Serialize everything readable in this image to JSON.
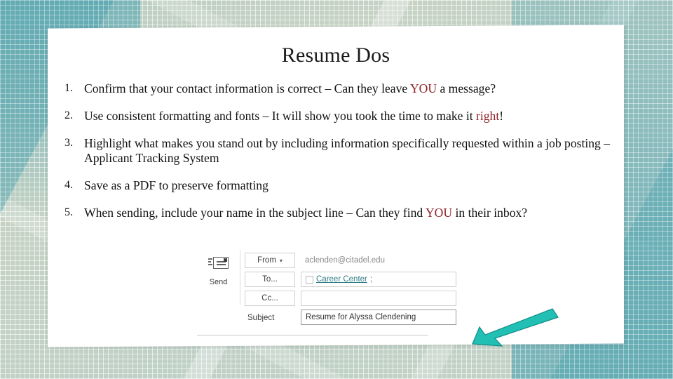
{
  "slide": {
    "title": "Resume Dos",
    "items": [
      {
        "num": "1.",
        "parts": [
          {
            "t": "Confirm that your contact information is correct – Can they leave ",
            "hl": false
          },
          {
            "t": "YOU",
            "hl": true
          },
          {
            "t": " a message?",
            "hl": false
          }
        ]
      },
      {
        "num": "2.",
        "parts": [
          {
            "t": "Use consistent formatting and fonts – It will show you took the time to make it ",
            "hl": false
          },
          {
            "t": "right",
            "hl": true
          },
          {
            "t": "!",
            "hl": false
          }
        ]
      },
      {
        "num": "3.",
        "parts": [
          {
            "t": "Highlight what makes you stand out by including information specifically requested within a job posting – Applicant Tracking System",
            "hl": false
          }
        ]
      },
      {
        "num": "4.",
        "parts": [
          {
            "t": "Save as a PDF to preserve formatting",
            "hl": false
          }
        ]
      },
      {
        "num": "5.",
        "parts": [
          {
            "t": "When sending, include your name in the subject line – Can they find ",
            "hl": false
          },
          {
            "t": "YOU",
            "hl": true
          },
          {
            "t": " in their inbox?",
            "hl": false
          }
        ]
      }
    ]
  },
  "email": {
    "send_label": "Send",
    "from_label": "From",
    "from_caret": "▾",
    "to_label": "To...",
    "cc_label": "Cc...",
    "subject_label": "Subject",
    "from_value": "aclenden@citadel.edu",
    "to_value": "Career Center",
    "to_separator": ";",
    "cc_value": "",
    "subject_value": "Resume for Alyssa Clendening"
  },
  "colors": {
    "highlight": "#8d2227",
    "arrow": "#22bfb4",
    "arrow_stroke": "#0f8d86",
    "background_sage": "#c3d2c6",
    "background_teal": "#5da8b0",
    "link": "#2f7d86"
  }
}
